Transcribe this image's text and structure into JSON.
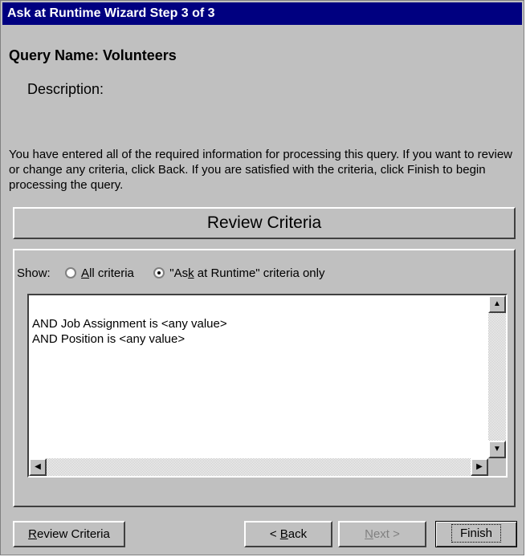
{
  "window": {
    "title": "Ask at Runtime Wizard Step 3 of 3"
  },
  "query": {
    "name_label": "Query Name: Volunteers",
    "description_label": "Description:"
  },
  "info_text": "You have entered all of the required information for processing this query.  If you want to review or change any criteria, click Back.  If you are satisfied with the criteria, click Finish to begin processing the query.",
  "review": {
    "header": "Review Criteria",
    "show_label": "Show:",
    "options": [
      {
        "label_prefix": "",
        "label_underline": "A",
        "label_suffix": "ll criteria",
        "selected": false
      },
      {
        "label_prefix": "\"As",
        "label_underline": "k",
        "label_suffix": " at Runtime\" criteria only",
        "selected": true
      }
    ],
    "criteria": [
      "AND Job Assignment is <any value>",
      "AND Position is <any value>"
    ]
  },
  "buttons": {
    "review_underline": "R",
    "review_rest": "eview Criteria",
    "back_prefix": "< ",
    "back_underline": "B",
    "back_rest": "ack",
    "next_underline": "N",
    "next_rest": "ext >",
    "finish": "Finish"
  },
  "icons": [
    "up-arrow-icon",
    "down-arrow-icon",
    "left-arrow-icon",
    "right-arrow-icon"
  ]
}
